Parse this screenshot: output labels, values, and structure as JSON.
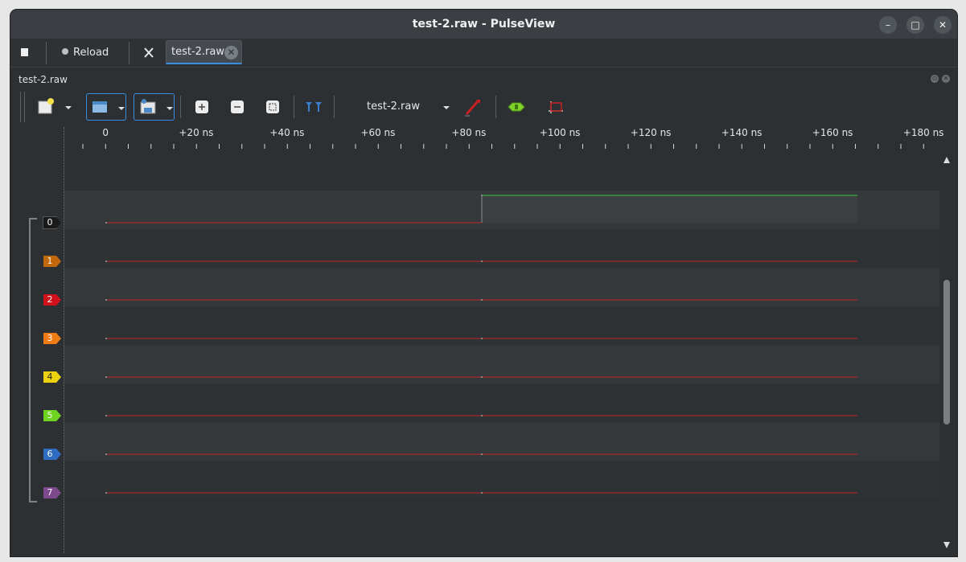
{
  "window": {
    "title": "test-2.raw - PulseView"
  },
  "tabbar": {
    "reload_label": "Reload",
    "document_tab_label": "test-2.raw"
  },
  "dock": {
    "title": "test-2.raw"
  },
  "toolbar": {
    "session_selector_label": "test-2.raw"
  },
  "ruler": {
    "labels": [
      "0",
      "+20 ns",
      "+40 ns",
      "+60 ns",
      "+80 ns",
      "+100 ns",
      "+120 ns",
      "+140 ns",
      "+160 ns",
      "+180 ns"
    ]
  },
  "channels": [
    {
      "name": "0",
      "color": "#1a1a1a"
    },
    {
      "name": "1",
      "color": "#c0680a"
    },
    {
      "name": "2",
      "color": "#d0101a"
    },
    {
      "name": "3",
      "color": "#ef7b14"
    },
    {
      "name": "4",
      "color": "#ecd20d"
    },
    {
      "name": "5",
      "color": "#6fd322"
    },
    {
      "name": "6",
      "color": "#2f6dc2"
    },
    {
      "name": "7",
      "color": "#7d4a8e"
    }
  ],
  "colors": {
    "low_trace": "#c1252a",
    "high_trace": "#36c23d",
    "accent": "#3a8ee0"
  },
  "icons": [
    "stop-icon",
    "record-icon",
    "wrench-icon",
    "close-icon",
    "new-session-icon",
    "open-icon",
    "save-icon",
    "zoom-in-icon",
    "zoom-out-icon",
    "zoom-fit-icon",
    "cursor-icon",
    "probe-icon",
    "decoder-icon",
    "math-icon"
  ]
}
